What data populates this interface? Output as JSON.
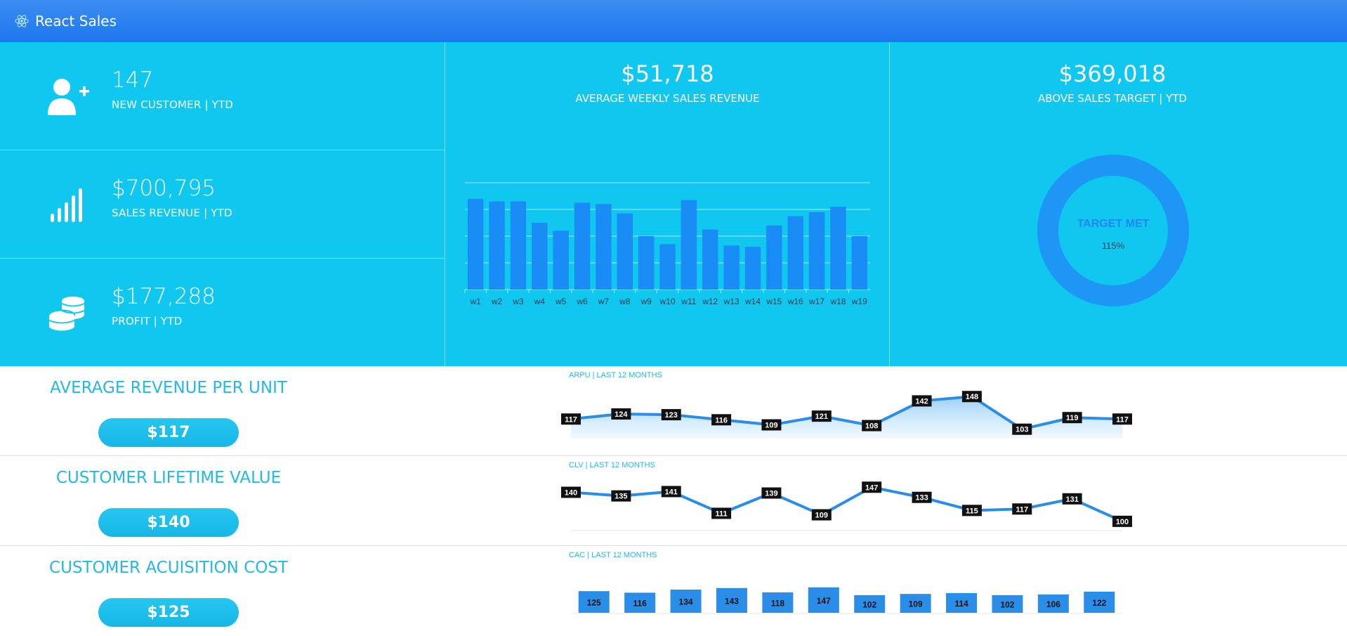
{
  "app": {
    "title": "React Sales"
  },
  "kpis": [
    {
      "value": "147",
      "label": "NEW CUSTOMER | YTD",
      "icon": "user-plus-icon"
    },
    {
      "value": "$700,795",
      "label": "SALES REVENUE | YTD",
      "icon": "signal-bars-icon"
    },
    {
      "value": "$177,288",
      "label": "PROFIT | YTD",
      "icon": "coins-icon"
    }
  ],
  "weekly": {
    "value": "$51,718",
    "label": "AVERAGE WEEKLY SALES REVENUE"
  },
  "target": {
    "value": "$369,018",
    "label": "ABOVE SALES TARGET | YTD",
    "donut_label": "TARGET MET",
    "donut_percent": "115%"
  },
  "rows": [
    {
      "title": "AVERAGE REVENUE PER UNIT",
      "pill": "$117",
      "chart_title": "ARPU | LAST 12 MONTHS"
    },
    {
      "title": "CUSTOMER LIFETIME VALUE",
      "pill": "$140",
      "chart_title": "CLV | LAST 12 MONTHS"
    },
    {
      "title": "CUSTOMER ACUISITION COST",
      "pill": "$125",
      "chart_title": "CAC | LAST 12 MONTHS"
    }
  ],
  "colors": {
    "header": "#1e77f0",
    "band": "#10c7ef",
    "bar": "#1a8cf5",
    "accent": "#22b9e3",
    "line": "#2a8ee8"
  },
  "chart_data": [
    {
      "type": "bar",
      "categories": [
        "w1",
        "w2",
        "w3",
        "w4",
        "w5",
        "w6",
        "w7",
        "w8",
        "w9",
        "w10",
        "w11",
        "w12",
        "w13",
        "w14",
        "w15",
        "w16",
        "w17",
        "w18",
        "w19"
      ],
      "values": [
        68,
        66,
        66,
        50,
        44,
        65,
        64,
        57,
        40,
        34,
        67,
        45,
        33,
        32,
        48,
        55,
        58,
        62,
        40
      ],
      "ylim": [
        0,
        80
      ],
      "grid": true
    },
    {
      "type": "area",
      "values": [
        117,
        124,
        123,
        116,
        109,
        121,
        108,
        142,
        148,
        103,
        119,
        117
      ],
      "ylim": [
        95,
        155
      ]
    },
    {
      "type": "line",
      "values": [
        140,
        135,
        141,
        111,
        139,
        109,
        147,
        133,
        115,
        117,
        131,
        100
      ],
      "ylim": [
        95,
        155
      ]
    },
    {
      "type": "bar",
      "values": [
        125,
        116,
        134,
        143,
        118,
        147,
        102,
        109,
        114,
        102,
        106,
        122
      ],
      "ylim": [
        0,
        150
      ]
    }
  ]
}
